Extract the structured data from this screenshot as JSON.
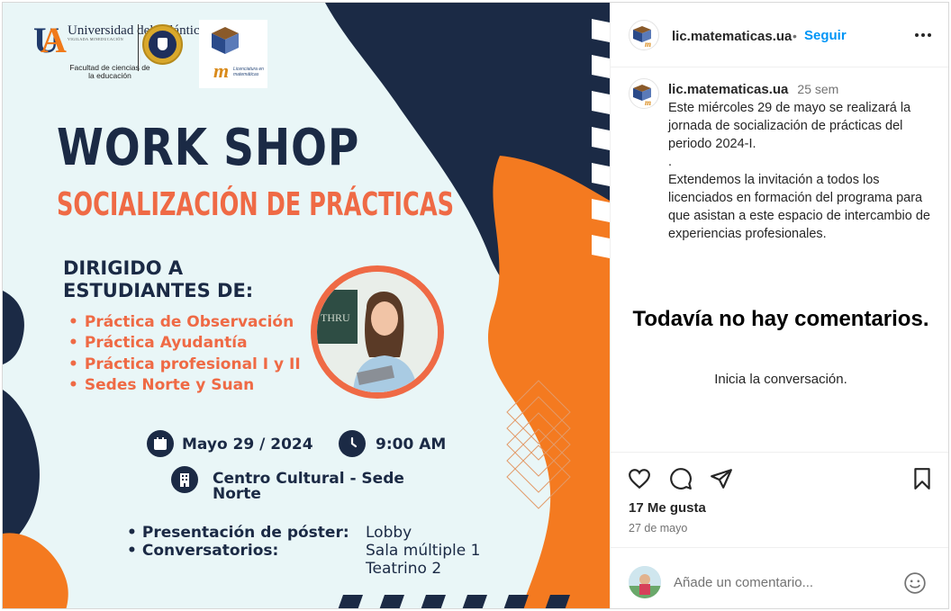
{
  "poster": {
    "university_name": "Universidad del Atlántico",
    "university_tagline": "VIGILADA MINEDUCACIÓN",
    "faculty": "Facultad de ciencias de la educación",
    "program_logo_letter": "m",
    "program_logo_text": "Licenciatura en matemáticas",
    "title": "WORK SHOP",
    "subtitle": "SOCIALIZACIÓN DE PRÁCTICAS",
    "audience_heading": "DIRIGIDO A ESTUDIANTES DE:",
    "audience": [
      "Práctica de Observación",
      "Práctica Ayudantía",
      "Práctica profesional I y II",
      "Sedes Norte y Suan"
    ],
    "date": "Mayo 29 / 2024",
    "time": "9:00 AM",
    "venue": "Centro Cultural - Sede Norte",
    "activities": [
      "Presentación de póster:",
      "Conversatorios:"
    ],
    "locations": [
      "Lobby",
      "Sala múltiple 1",
      "Teatrino 2"
    ],
    "colors": {
      "navy": "#1b2a45",
      "orange": "#f47a20",
      "coral": "#ef6a45",
      "background": "#e9f6f7"
    }
  },
  "post": {
    "username": "lic.matematicas.ua",
    "follow_label": "Seguir",
    "separator": "•",
    "time_ago": "25 sem",
    "caption": "Este miércoles 29 de mayo se realizará la jornada de socialización de prácticas del periodo 2024-I.\n.\nExtendemos la invitación a todos los licenciados en formación del programa para que asistan a este espacio de intercambio de experiencias profesionales.",
    "empty_title": "Todavía no hay comentarios.",
    "empty_subtitle": "Inicia la conversación.",
    "likes": "17 Me gusta",
    "date": "27 de mayo",
    "comment_placeholder": "Añade un comentario...",
    "icons": [
      "heart-icon",
      "comment-icon",
      "share-icon",
      "bookmark-icon",
      "more-icon",
      "emoji-icon",
      "calendar-icon",
      "clock-icon",
      "building-icon"
    ],
    "accent_color": "#0095f6"
  }
}
